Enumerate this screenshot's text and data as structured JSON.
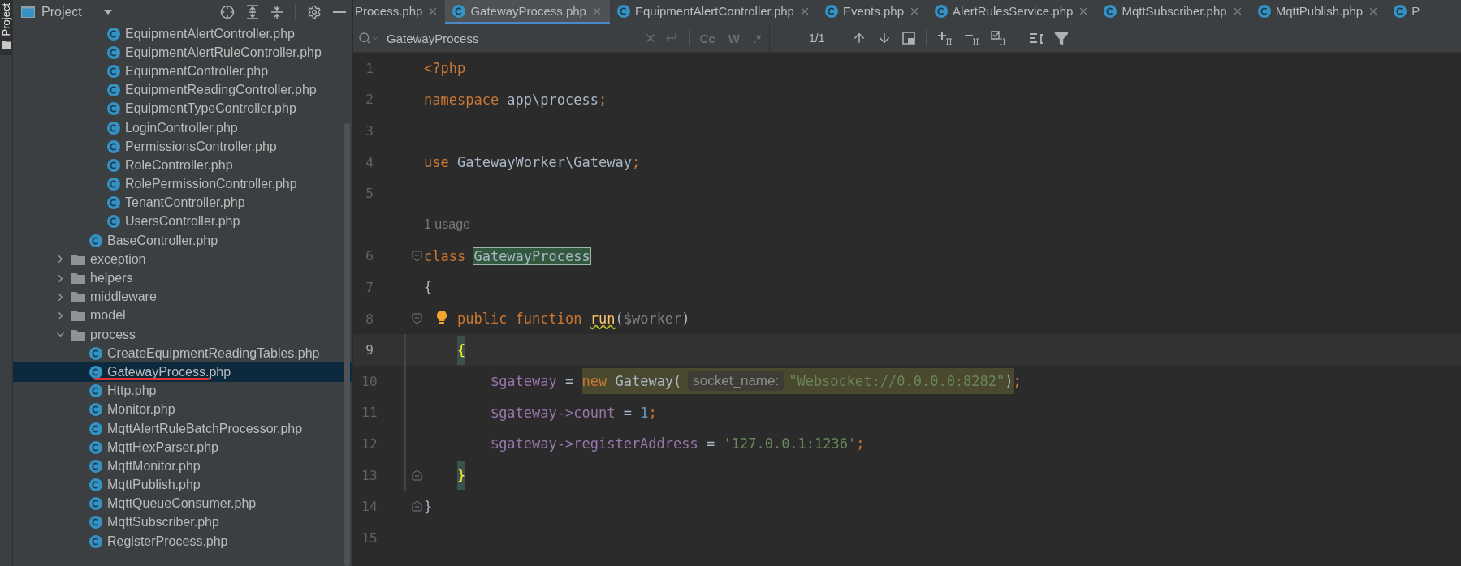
{
  "side_strip": {
    "label": "Project"
  },
  "project_panel": {
    "title": "Project",
    "tree": [
      {
        "children": [
          {
            "children": [
              {
                "label": "EquipmentAlertController.php",
                "kind": "file",
                "selected": false
              },
              {
                "label": "EquipmentAlertRuleController.php",
                "kind": "file",
                "selected": false
              },
              {
                "label": "EquipmentController.php",
                "kind": "file",
                "selected": false
              },
              {
                "label": "EquipmentReadingController.php",
                "kind": "file",
                "selected": false
              },
              {
                "label": "EquipmentTypeController.php",
                "kind": "file",
                "selected": false
              },
              {
                "label": "LoginController.php",
                "kind": "file",
                "selected": false
              },
              {
                "label": "PermissionsController.php",
                "kind": "file",
                "selected": false
              },
              {
                "label": "RoleController.php",
                "kind": "file",
                "selected": false
              },
              {
                "label": "RolePermissionController.php",
                "kind": "file",
                "selected": false
              },
              {
                "label": "TenantController.php",
                "kind": "file",
                "selected": false
              },
              {
                "label": "UsersController.php",
                "kind": "file",
                "selected": false
              }
            ]
          },
          {
            "label": "BaseController.php",
            "kind": "file",
            "selected": false
          }
        ]
      },
      {
        "label": "exception",
        "kind": "folder",
        "expanded": false,
        "selected": false
      },
      {
        "label": "helpers",
        "kind": "folder",
        "expanded": false,
        "selected": false
      },
      {
        "label": "middleware",
        "kind": "folder",
        "expanded": false,
        "selected": false
      },
      {
        "label": "model",
        "kind": "folder",
        "expanded": false,
        "selected": false
      },
      {
        "label": "process",
        "kind": "folder",
        "expanded": true,
        "selected": false,
        "children": [
          {
            "label": "CreateEquipmentReadingTables.php",
            "kind": "file",
            "selected": false
          },
          {
            "label": "GatewayProcess.php",
            "kind": "file",
            "selected": true
          },
          {
            "label": "Http.php",
            "kind": "file",
            "selected": false
          },
          {
            "label": "Monitor.php",
            "kind": "file",
            "selected": false
          },
          {
            "label": "MqttAlertRuleBatchProcessor.php",
            "kind": "file",
            "selected": false
          },
          {
            "label": "MqttHexParser.php",
            "kind": "file",
            "selected": false
          },
          {
            "label": "MqttMonitor.php",
            "kind": "file",
            "selected": false
          },
          {
            "label": "MqttPublish.php",
            "kind": "file",
            "selected": false
          },
          {
            "label": "MqttQueueConsumer.php",
            "kind": "file",
            "selected": false
          },
          {
            "label": "MqttSubscriber.php",
            "kind": "file",
            "selected": false
          },
          {
            "label": "RegisterProcess.php",
            "kind": "file",
            "selected": false
          }
        ]
      }
    ]
  },
  "tabs": [
    {
      "label": "Process.php",
      "kind": "partial",
      "selected": false
    },
    {
      "label": "GatewayProcess.php",
      "kind": "file",
      "selected": true
    },
    {
      "label": "EquipmentAlertController.php",
      "kind": "file",
      "selected": false
    },
    {
      "label": "Events.php",
      "kind": "file",
      "selected": false
    },
    {
      "label": "AlertRulesService.php",
      "kind": "file",
      "selected": false
    },
    {
      "label": "MqttSubscriber.php",
      "kind": "file",
      "selected": false
    },
    {
      "label": "MqttPublish.php",
      "kind": "file",
      "selected": false
    },
    {
      "label": "P",
      "kind": "file",
      "selected": false
    }
  ],
  "find": {
    "value": "GatewayProcess",
    "options": [
      {
        "label": "Cc",
        "on": false
      },
      {
        "label": "W",
        "on": false
      },
      {
        "label": ".*",
        "on": false
      }
    ],
    "matches": "1/1"
  },
  "lines": [
    {
      "kind": "code",
      "number": "1",
      "current": false,
      "changed": false,
      "fold_start": false,
      "fold_end": false,
      "bulb": false,
      "tokens": [
        {
          "kind": "keyword",
          "text": "<?php"
        }
      ]
    },
    {
      "kind": "code",
      "number": "2",
      "current": false,
      "changed": false,
      "fold_start": false,
      "fold_end": false,
      "bulb": false,
      "tokens": [
        {
          "kind": "keyword",
          "text": "namespace"
        },
        {
          "kind": "plain",
          "text": " app\\process"
        },
        {
          "kind": "punct",
          "text": ";"
        }
      ]
    },
    {
      "kind": "code",
      "number": "3",
      "current": false,
      "changed": false,
      "fold_start": false,
      "fold_end": false,
      "bulb": false
    },
    {
      "kind": "code",
      "number": "4",
      "current": false,
      "changed": false,
      "fold_start": false,
      "fold_end": false,
      "bulb": false,
      "tokens": [
        {
          "kind": "keyword",
          "text": "use"
        },
        {
          "kind": "plain",
          "text": " GatewayWorker\\Gateway"
        },
        {
          "kind": "punct",
          "text": ";"
        }
      ]
    },
    {
      "kind": "code",
      "number": "5",
      "current": false,
      "changed": false,
      "fold_start": false,
      "fold_end": false,
      "bulb": false
    },
    {
      "kind": "inlay",
      "text": "1 usage"
    },
    {
      "kind": "code",
      "number": "6",
      "current": false,
      "changed": false,
      "fold_start": true,
      "fold_end": false,
      "bulb": false,
      "tokens": [
        {
          "kind": "keyword",
          "text": "class "
        },
        {
          "kind": "plain",
          "text": "GatewayProcess",
          "match": true
        }
      ]
    },
    {
      "kind": "code",
      "number": "7",
      "current": false,
      "changed": false,
      "fold_start": false,
      "fold_end": false,
      "bulb": false,
      "tokens": [
        {
          "kind": "plain",
          "text": "{"
        }
      ]
    },
    {
      "kind": "code",
      "number": "8",
      "current": false,
      "changed": false,
      "fold_start": true,
      "fold_end": false,
      "bulb": true,
      "tokens": [
        {
          "kind": "keyword",
          "text": "    public function "
        },
        {
          "kind": "function",
          "text": "run",
          "squiggle": true
        },
        {
          "kind": "plain",
          "text": "("
        },
        {
          "kind": "unused",
          "text": "$worker"
        },
        {
          "kind": "plain",
          "text": ")"
        }
      ]
    },
    {
      "kind": "code",
      "number": "9",
      "current": true,
      "changed": true,
      "fold_start": false,
      "fold_end": false,
      "bulb": false,
      "tokens": [
        {
          "kind": "brace",
          "text": "    {",
          "paired": true
        }
      ]
    },
    {
      "kind": "code",
      "number": "10",
      "current": false,
      "changed": true,
      "fold_start": false,
      "fold_end": false,
      "bulb": false,
      "tokens": [
        {
          "kind": "variable",
          "text": "        $gateway"
        },
        {
          "kind": "plain",
          "text": " = "
        },
        {
          "kind": "usage",
          "tokens": [
            {
              "kind": "keyword",
              "text": "new"
            },
            {
              "kind": "plain",
              "text": " Gateway("
            },
            {
              "kind": "hint",
              "text": "socket_name:"
            },
            {
              "kind": "string",
              "text": "\"Websocket://0.0.0.0:8282\""
            },
            {
              "kind": "plain",
              "text": ")"
            }
          ]
        },
        {
          "kind": "punct",
          "text": ";"
        }
      ]
    },
    {
      "kind": "code",
      "number": "11",
      "current": false,
      "changed": true,
      "fold_start": false,
      "fold_end": false,
      "bulb": false,
      "tokens": [
        {
          "kind": "variable",
          "text": "        $gateway->count"
        },
        {
          "kind": "plain",
          "text": " = "
        },
        {
          "kind": "number",
          "text": "1"
        },
        {
          "kind": "punct",
          "text": ";"
        }
      ]
    },
    {
      "kind": "code",
      "number": "12",
      "current": false,
      "changed": true,
      "fold_start": false,
      "fold_end": false,
      "bulb": false,
      "tokens": [
        {
          "kind": "variable",
          "text": "        $gateway->registerAddress"
        },
        {
          "kind": "plain",
          "text": " = "
        },
        {
          "kind": "string",
          "text": "'127.0.0.1:1236'"
        },
        {
          "kind": "punct",
          "text": ";"
        }
      ]
    },
    {
      "kind": "code",
      "number": "13",
      "current": false,
      "changed": true,
      "fold_start": false,
      "fold_end": true,
      "bulb": false,
      "tokens": [
        {
          "kind": "brace",
          "text": "    }",
          "paired": true
        }
      ]
    },
    {
      "kind": "code",
      "number": "14",
      "current": false,
      "changed": false,
      "fold_start": false,
      "fold_end": true,
      "bulb": false,
      "tokens": [
        {
          "kind": "plain",
          "text": "}"
        }
      ]
    },
    {
      "kind": "code",
      "number": "15",
      "current": false,
      "changed": false,
      "fold_start": false,
      "fold_end": false,
      "bulb": false
    }
  ]
}
